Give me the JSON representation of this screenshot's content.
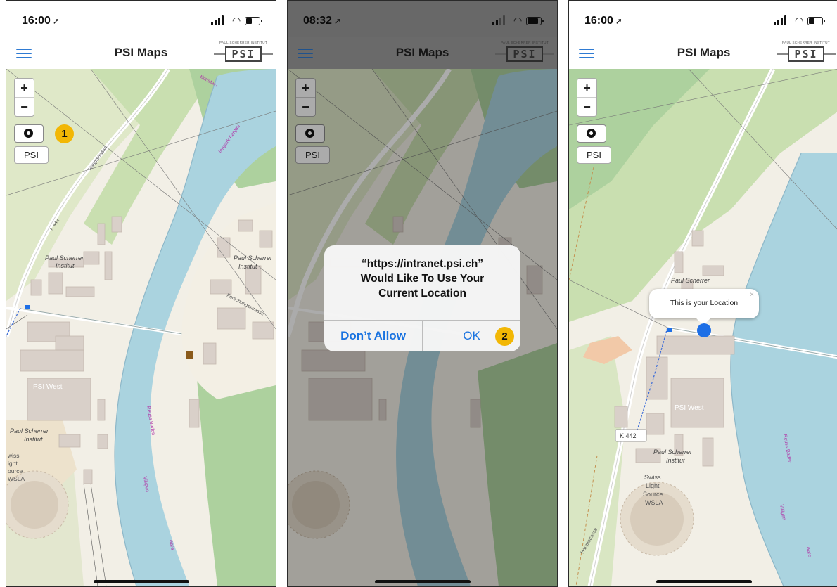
{
  "screens": [
    {
      "time": "16:00",
      "title": "PSI Maps",
      "logo_small": "PAUL SCHERRER INSTITUT",
      "logo_word": "PSI",
      "zoom_in": "+",
      "zoom_out": "−",
      "psi_button": "PSI",
      "step_badge": "1",
      "map_labels": {
        "road_top": "Hauptstrasse",
        "road_k": "K 442",
        "psi_east": "Paul Scherrer",
        "psi_east_2": "Institut",
        "psi_east_b": "Paul Scherrer",
        "psi_east_b2": "Institut",
        "psi_west": "PSI West",
        "psi_west_b": "Paul Scherrer",
        "psi_west_b2": "Institut",
        "sls_1": "wiss",
        "sls_2": "ight",
        "sls_3": "ource",
        "sls_4": "WSLA",
        "street_forsch": "Forschungsstrasse",
        "river_1": "Reuss Baden",
        "river_2": "Villigen",
        "river_3": "Aare",
        "top_1": "Böttstein",
        "top_2": "Innpark Aargau"
      }
    },
    {
      "time": "08:32",
      "title": "PSI Maps",
      "logo_small": "PAUL SCHERRER INSTITUT",
      "logo_word": "PSI",
      "zoom_in": "+",
      "zoom_out": "−",
      "psi_button": "PSI",
      "step_badge": "2",
      "alert_line1": "“https://intranet.psi.ch”",
      "alert_line2": "Would Like To Use Your",
      "alert_line3": "Current Location",
      "alert_deny": "Don’t Allow",
      "alert_ok": "OK"
    },
    {
      "time": "16:00",
      "title": "PSI Maps",
      "logo_small": "PAUL SCHERRER INSTITUT",
      "logo_word": "PSI",
      "zoom_in": "+",
      "zoom_out": "−",
      "psi_button": "PSI",
      "popup_text": "This is your Location",
      "popup_close": "×",
      "map_labels": {
        "psi_scherrer": "Paul Scherrer",
        "psi_west": "PSI West",
        "k442": "K 442",
        "psi_b1": "Paul Scherrer",
        "psi_b2": "Institut",
        "sls_1": "Swiss",
        "sls_2": "Light",
        "sls_3": "Source",
        "sls_4": "WSLA",
        "road": "Hauptstrasse",
        "river_1": "Reuss Baden",
        "river_2": "Villigen",
        "river_3": "Aare"
      }
    }
  ],
  "colors": {
    "accent": "#2f7bd3",
    "badge": "#f2b705",
    "river": "#aad3df",
    "forest": "#add19e"
  }
}
